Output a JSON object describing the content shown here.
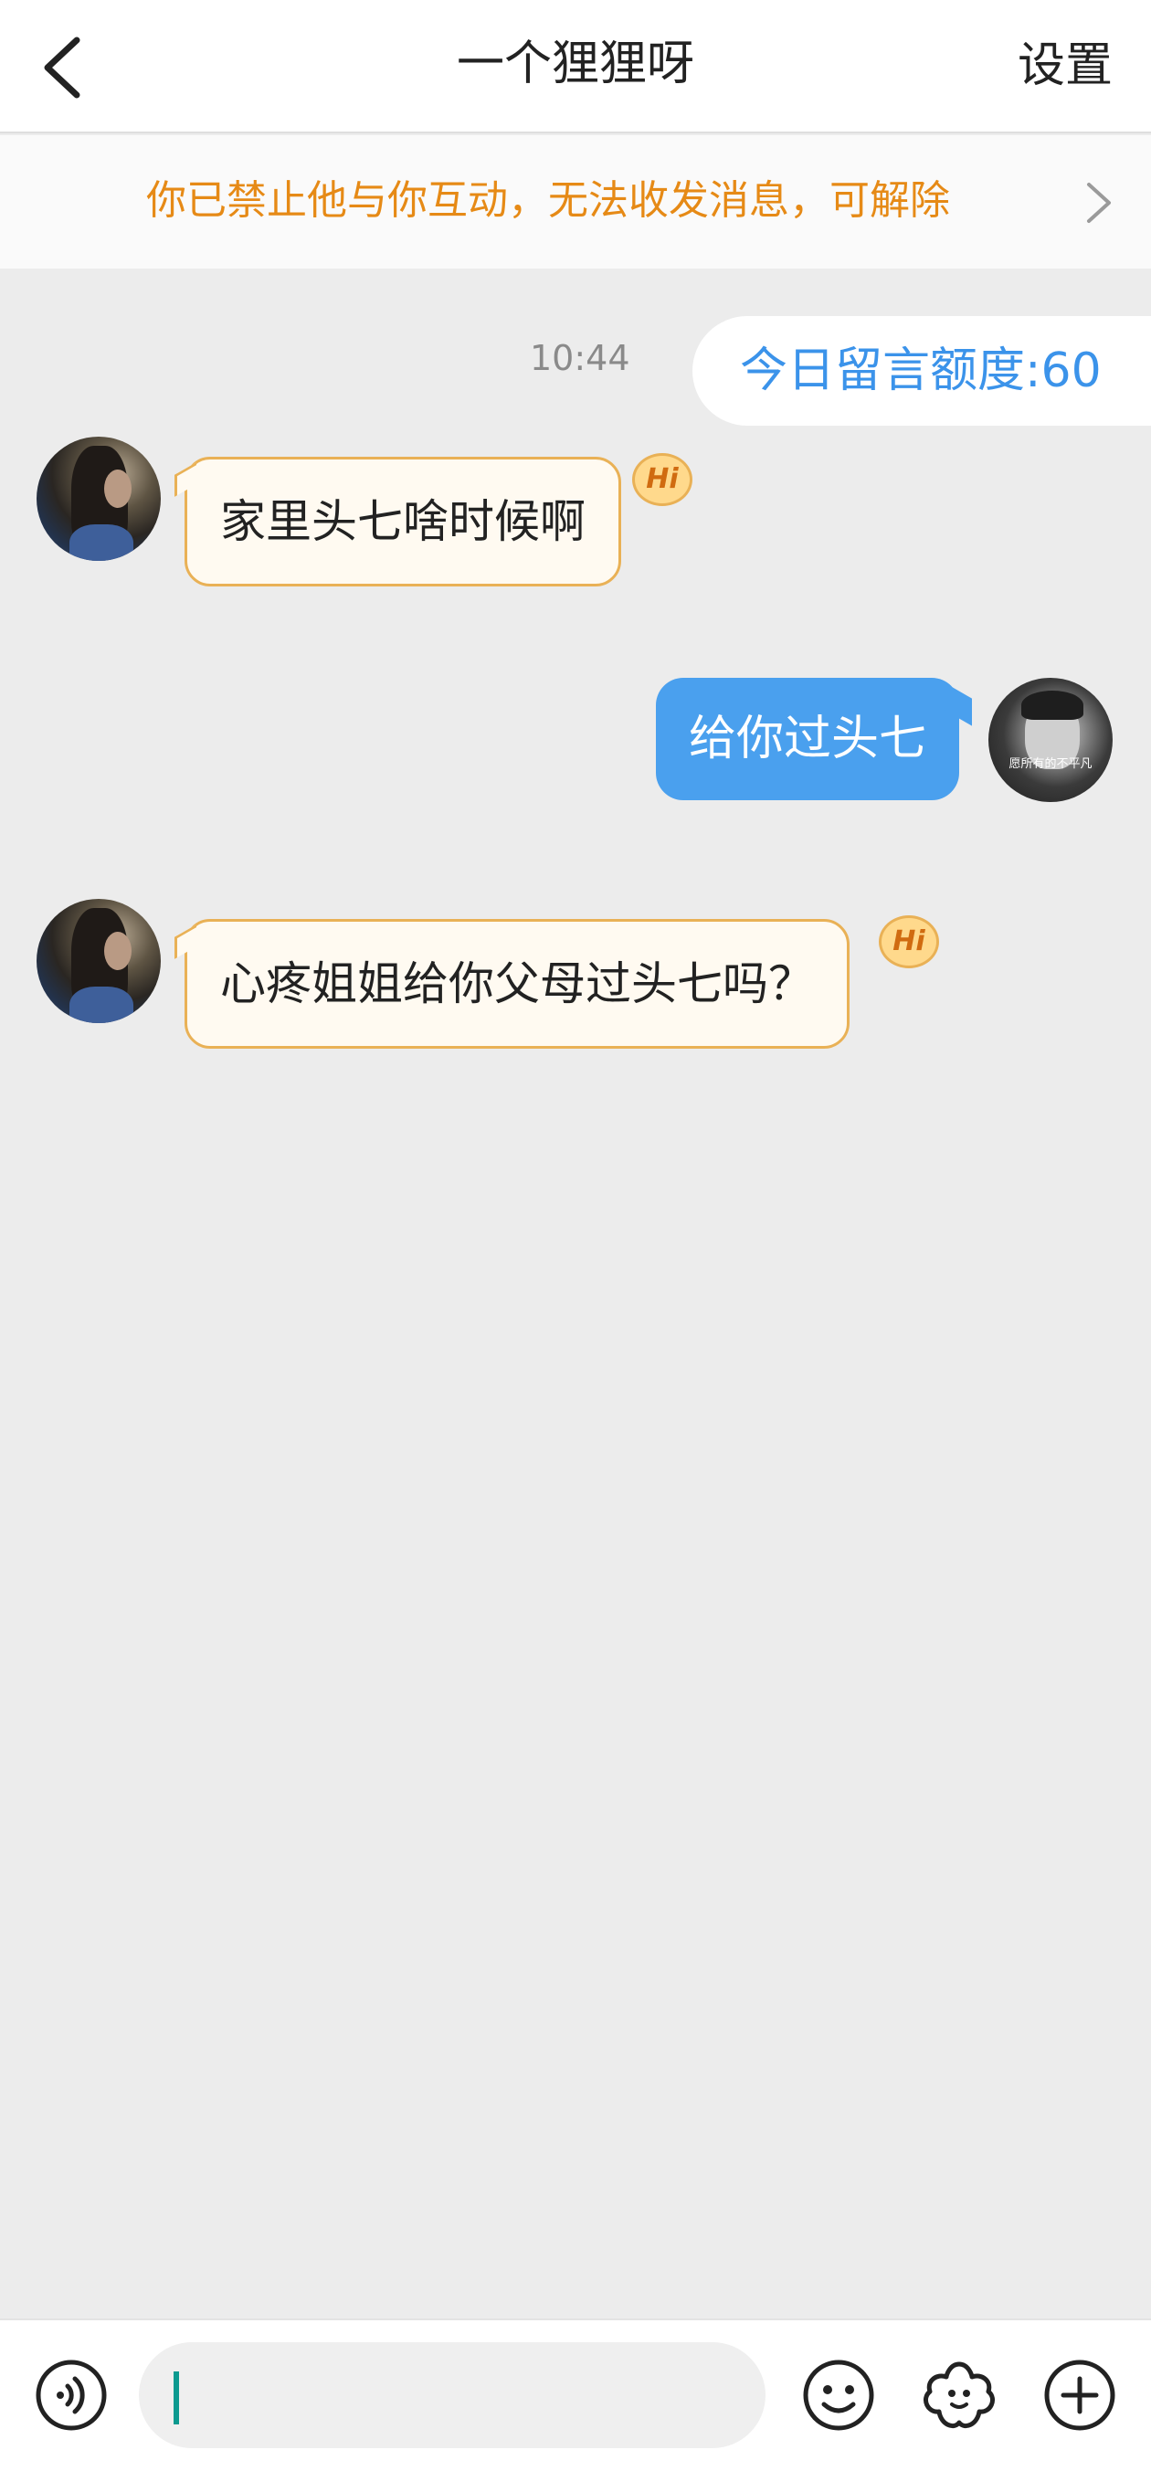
{
  "header": {
    "title": "一个狸狸呀",
    "settings_label": "设置"
  },
  "banner": {
    "text": "你已禁止他与你互动，无法收发消息，可解除"
  },
  "chat": {
    "time": "10:44",
    "quota": "今日留言额度:60",
    "messages": [
      {
        "side": "in",
        "text": "家里头七啥时候啊",
        "badge": "Hi"
      },
      {
        "side": "out",
        "text": "给你过头七"
      },
      {
        "side": "in",
        "text": "心疼姐姐给你父母过头七吗？",
        "badge": "Hi"
      }
    ],
    "my_avatar_caption": "愿所有的不平凡"
  },
  "input": {
    "value": ""
  },
  "colors": {
    "accent_blue": "#4aa0ee",
    "warning_orange": "#e68a16",
    "incoming_bubble_border": "#e9b156",
    "cursor": "#0b9a8f"
  },
  "icons": [
    "back-chevron-icon",
    "chevron-right-icon",
    "voice-icon",
    "emoji-icon",
    "sticker-icon",
    "plus-icon"
  ]
}
